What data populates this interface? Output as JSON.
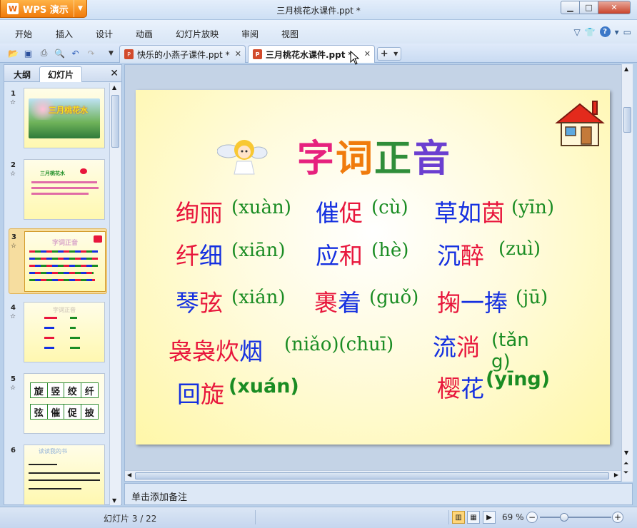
{
  "app": {
    "wps_label": "WPS 演示",
    "window_title": "三月桃花水课件.ppt *"
  },
  "menu": {
    "items": [
      "开始",
      "插入",
      "设计",
      "动画",
      "幻灯片放映",
      "审阅",
      "视图"
    ]
  },
  "tabs": [
    {
      "label": "快乐的小燕子课件.ppt *"
    },
    {
      "label": "三月桃花水课件.ppt *"
    }
  ],
  "panel": {
    "tab_outline": "大纲",
    "tab_slides": "幻灯片",
    "thumbs": [
      {
        "num": "1",
        "title": "三月桃花水"
      },
      {
        "num": "2",
        "title": "三月桃花水"
      },
      {
        "num": "3",
        "title": "字词正音"
      },
      {
        "num": "4",
        "title": "字词正音"
      },
      {
        "num": "5",
        "grid": [
          "旋",
          "竖",
          "绞",
          "纤",
          "弦",
          "催",
          "促",
          "披"
        ]
      },
      {
        "num": "6",
        "title": "读读我的书"
      }
    ]
  },
  "slide": {
    "title_chars": [
      "字",
      "词",
      "正",
      "音"
    ],
    "words": [
      {
        "a": "绚",
        "b": "丽",
        "py": "(xuàn)"
      },
      {
        "a": "催",
        "b": "促",
        "py": "(cù)"
      },
      {
        "a": "草如",
        "b": "茵",
        "py": "(yīn)"
      },
      {
        "a": "纤",
        "b": "细",
        "py": "(xiān)"
      },
      {
        "a": "应",
        "b": "和",
        "py": "(hè)"
      },
      {
        "a": "沉",
        "b": "醉",
        "py": "(zuì)"
      },
      {
        "a": "琴",
        "b": "弦",
        "py": "(xián)"
      },
      {
        "a": "裹",
        "b": "着",
        "py": "(guǒ)"
      },
      {
        "a": "掬",
        "b": "一捧",
        "py": "(jū)"
      },
      {
        "a": "袅袅",
        "b": "炊",
        "c": "烟",
        "py": "(niǎo)(chuī)"
      },
      {
        "a": "流",
        "b": "淌",
        "py": "(tǎn g)"
      },
      {
        "a": "回",
        "b": "旋",
        "py": "(xuán)"
      },
      {
        "a": "樱",
        "b": "花",
        "py": "(yīng)"
      }
    ]
  },
  "notes": {
    "placeholder": "单击添加备注"
  },
  "status": {
    "slide_info": "幻灯片 3 / 22",
    "zoom": "69 %"
  },
  "colors": {
    "accent": "#f07b0c",
    "chrome": "#cddff4",
    "slide_bg": "#fff7a8"
  }
}
